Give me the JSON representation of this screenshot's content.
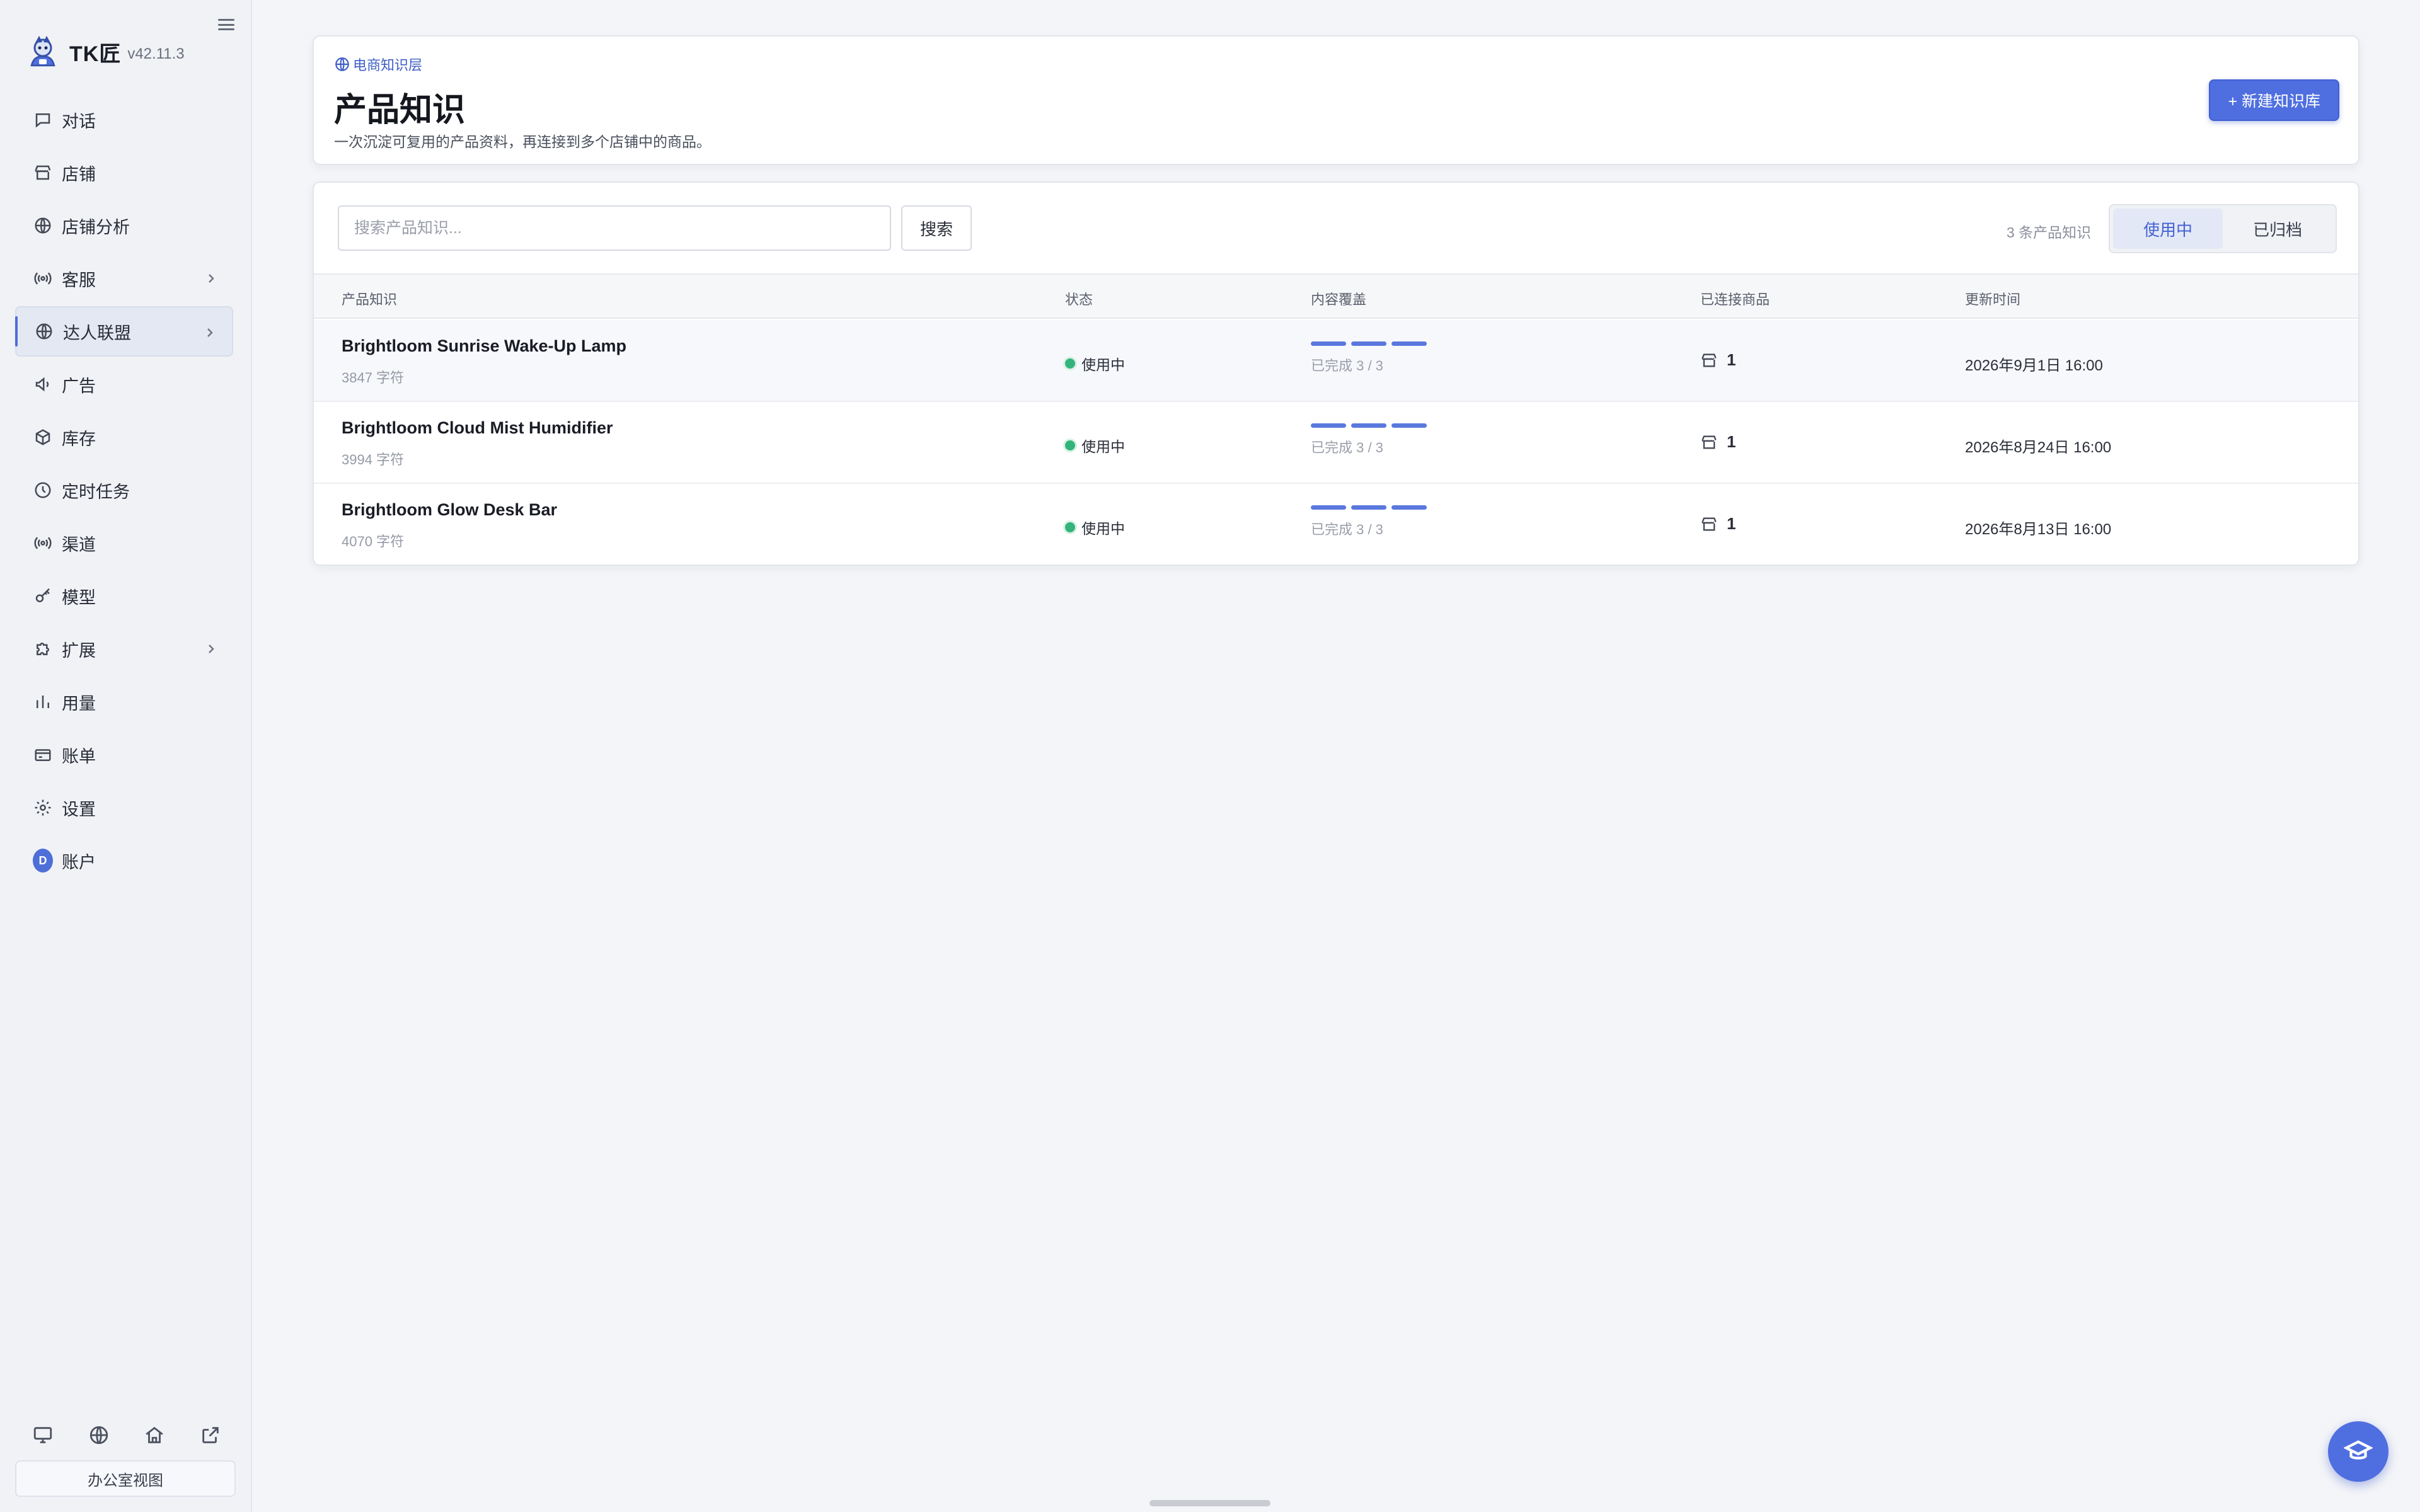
{
  "app": {
    "name": "TK匠",
    "version": "v42.11.3"
  },
  "sidebar": {
    "items": [
      {
        "label": "对话",
        "icon": "chat-icon"
      },
      {
        "label": "店铺",
        "icon": "store-icon"
      },
      {
        "label": "店铺分析",
        "icon": "globe-icon"
      },
      {
        "label": "客服",
        "icon": "broadcast-icon",
        "has_submenu": true
      },
      {
        "label": "达人联盟",
        "icon": "globe-icon",
        "has_submenu": true,
        "active": true
      },
      {
        "label": "广告",
        "icon": "megaphone-icon"
      },
      {
        "label": "库存",
        "icon": "box-icon"
      },
      {
        "label": "定时任务",
        "icon": "clock-icon"
      },
      {
        "label": "渠道",
        "icon": "broadcast-icon"
      },
      {
        "label": "模型",
        "icon": "key-icon"
      },
      {
        "label": "扩展",
        "icon": "puzzle-icon",
        "has_submenu": true
      },
      {
        "label": "用量",
        "icon": "bar-chart-icon"
      },
      {
        "label": "账单",
        "icon": "wallet-icon"
      },
      {
        "label": "设置",
        "icon": "gear-icon"
      },
      {
        "label": "账户",
        "icon": "avatar",
        "avatar_letter": "D"
      }
    ],
    "bottom_icons": [
      "monitor-icon",
      "globe-icon",
      "home-icon",
      "external-link-icon"
    ],
    "office_view_label": "办公室视图"
  },
  "header": {
    "breadcrumb": "电商知识层",
    "title": "产品知识",
    "subtitle": "一次沉淀可复用的产品资料，再连接到多个店铺中的商品。",
    "new_button_label": "+ 新建知识库"
  },
  "list": {
    "search_placeholder": "搜索产品知识...",
    "search_button_label": "搜索",
    "count_text": "3 条产品知识",
    "tabs": [
      {
        "label": "使用中",
        "active": true
      },
      {
        "label": "已归档",
        "active": false
      }
    ],
    "columns": [
      "产品知识",
      "状态",
      "内容覆盖",
      "已连接商品",
      "更新时间"
    ],
    "rows": [
      {
        "name": "Brightloom Sunrise Wake-Up Lamp",
        "chars": "3847 字符",
        "status": "使用中",
        "coverage_done": 3,
        "coverage_total": 3,
        "coverage_text": "已完成 3 / 3",
        "linked": "1",
        "updated": "2026年9月1日 16:00"
      },
      {
        "name": "Brightloom Cloud Mist Humidifier",
        "chars": "3994 字符",
        "status": "使用中",
        "coverage_done": 3,
        "coverage_total": 3,
        "coverage_text": "已完成 3 / 3",
        "linked": "1",
        "updated": "2026年8月24日 16:00"
      },
      {
        "name": "Brightloom Glow Desk Bar",
        "chars": "4070 字符",
        "status": "使用中",
        "coverage_done": 3,
        "coverage_total": 3,
        "coverage_text": "已完成 3 / 3",
        "linked": "1",
        "updated": "2026年8月13日 16:00"
      }
    ]
  },
  "colors": {
    "accent": "#4f6fe0",
    "status_active": "#34b47a",
    "coverage_bar": "#5a78dd"
  }
}
